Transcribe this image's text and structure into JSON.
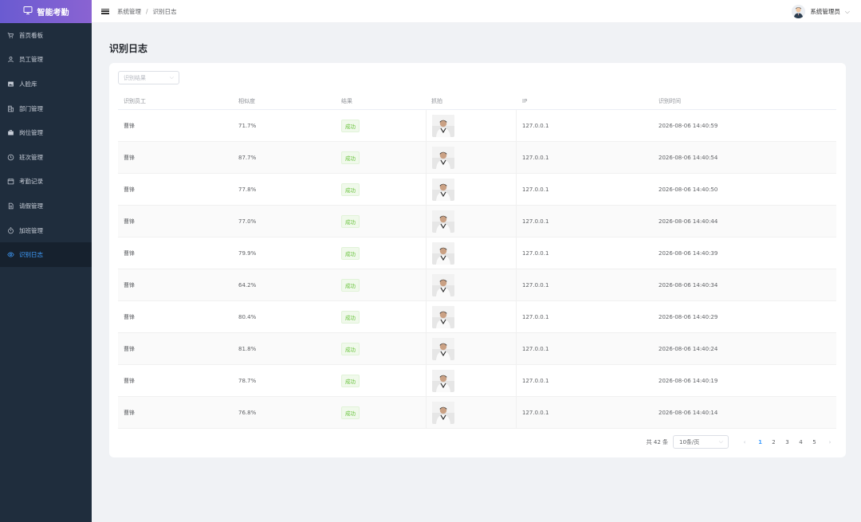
{
  "app": {
    "title": "智能考勤"
  },
  "sidebar": {
    "items": [
      {
        "label": "首页看板",
        "icon": "cart-icon",
        "active": false
      },
      {
        "label": "员工管理",
        "icon": "user-icon",
        "active": false
      },
      {
        "label": "人脸库",
        "icon": "image-icon",
        "active": false
      },
      {
        "label": "部门管理",
        "icon": "building-icon",
        "active": false
      },
      {
        "label": "岗位管理",
        "icon": "briefcase-icon",
        "active": false
      },
      {
        "label": "班次管理",
        "icon": "clock-icon",
        "active": false
      },
      {
        "label": "考勤记录",
        "icon": "calendar-icon",
        "active": false
      },
      {
        "label": "请假管理",
        "icon": "document-icon",
        "active": false
      },
      {
        "label": "加班管理",
        "icon": "stopwatch-icon",
        "active": false
      },
      {
        "label": "识别日志",
        "icon": "eye-icon",
        "active": true
      }
    ]
  },
  "header": {
    "breadcrumb": [
      "系统管理",
      "识别日志"
    ],
    "separator": "/",
    "user": "系统管理员"
  },
  "page": {
    "title": "识别日志"
  },
  "filter": {
    "placeholder": "识别结果"
  },
  "table": {
    "columns": [
      "识别员工",
      "相似度",
      "结果",
      "抓拍",
      "IP",
      "识别时间"
    ],
    "rows": [
      {
        "employee": "曹锋",
        "similarity": "71.7%",
        "result": "成功",
        "ip": "127.0.0.1",
        "time": "2026-08-06 14:40:59"
      },
      {
        "employee": "曹锋",
        "similarity": "87.7%",
        "result": "成功",
        "ip": "127.0.0.1",
        "time": "2026-08-06 14:40:54"
      },
      {
        "employee": "曹锋",
        "similarity": "77.8%",
        "result": "成功",
        "ip": "127.0.0.1",
        "time": "2026-08-06 14:40:50"
      },
      {
        "employee": "曹锋",
        "similarity": "77.0%",
        "result": "成功",
        "ip": "127.0.0.1",
        "time": "2026-08-06 14:40:44"
      },
      {
        "employee": "曹锋",
        "similarity": "79.9%",
        "result": "成功",
        "ip": "127.0.0.1",
        "time": "2026-08-06 14:40:39"
      },
      {
        "employee": "曹锋",
        "similarity": "64.2%",
        "result": "成功",
        "ip": "127.0.0.1",
        "time": "2026-08-06 14:40:34"
      },
      {
        "employee": "曹锋",
        "similarity": "80.4%",
        "result": "成功",
        "ip": "127.0.0.1",
        "time": "2026-08-06 14:40:29"
      },
      {
        "employee": "曹锋",
        "similarity": "81.8%",
        "result": "成功",
        "ip": "127.0.0.1",
        "time": "2026-08-06 14:40:24"
      },
      {
        "employee": "曹锋",
        "similarity": "78.7%",
        "result": "成功",
        "ip": "127.0.0.1",
        "time": "2026-08-06 14:40:19"
      },
      {
        "employee": "曹锋",
        "similarity": "76.8%",
        "result": "成功",
        "ip": "127.0.0.1",
        "time": "2026-08-06 14:40:14"
      }
    ]
  },
  "pagination": {
    "total_text": "共 42 条",
    "page_size": "10条/页",
    "pages": [
      "1",
      "2",
      "3",
      "4",
      "5"
    ],
    "current": "1",
    "prev": "‹",
    "next": "›"
  },
  "colors": {
    "sidebar_bg": "#1f2d3d",
    "logo_gradient": [
      "#6a5bd1",
      "#8a63d2"
    ],
    "accent": "#409eff",
    "success": "#67c23a"
  }
}
